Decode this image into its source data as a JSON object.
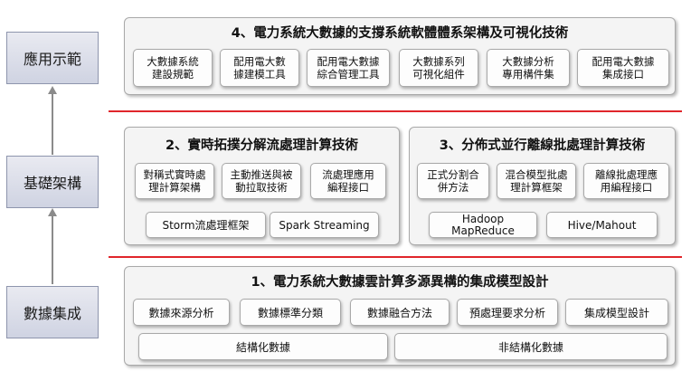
{
  "layers": {
    "application": "應用示範",
    "infrastructure": "基礎架構",
    "integration": "數據集成"
  },
  "panel4": {
    "title": "4、電力系統大數據的支撐系統軟體體系架構及可視化技術",
    "items": [
      "大數據系統\n建設規範",
      "配用電大數\n據建模工具",
      "配用電大數據\n綜合管理工具",
      "大數據系列\n可視化組件",
      "大數據分析\n專用構件集",
      "配用電大數據\n集成接口"
    ]
  },
  "panel2": {
    "title": "2、實時拓撲分解流處理計算技術",
    "items": [
      "對稱式實時處\n理計算架構",
      "主動推送與被\n動拉取技術",
      "流處理應用\n編程接口"
    ],
    "frameworks": [
      "Storm流處理框架",
      "Spark Streaming"
    ]
  },
  "panel3": {
    "title": "3、分佈式並行離線批處理計算技術",
    "items": [
      "正式分割合\n併方法",
      "混合模型批處\n理計算框架",
      "離線批處理應\n用編程接口"
    ],
    "frameworks": [
      "Hadoop\nMapReduce",
      "Hive/Mahout"
    ]
  },
  "panel1": {
    "title": "1、電力系統大數據雲計算多源異構的集成模型設計",
    "items": [
      "數據來源分析",
      "數據標準分類",
      "數據融合方法",
      "預處理要求分析",
      "集成模型設計"
    ],
    "data_types": [
      "結構化數據",
      "非結構化數據"
    ]
  },
  "colors": {
    "separator": "#e0262b",
    "layer_fill": "#d9dcea",
    "panel_fill": "#f4f4f4",
    "arrow": "#8b8b8b"
  }
}
